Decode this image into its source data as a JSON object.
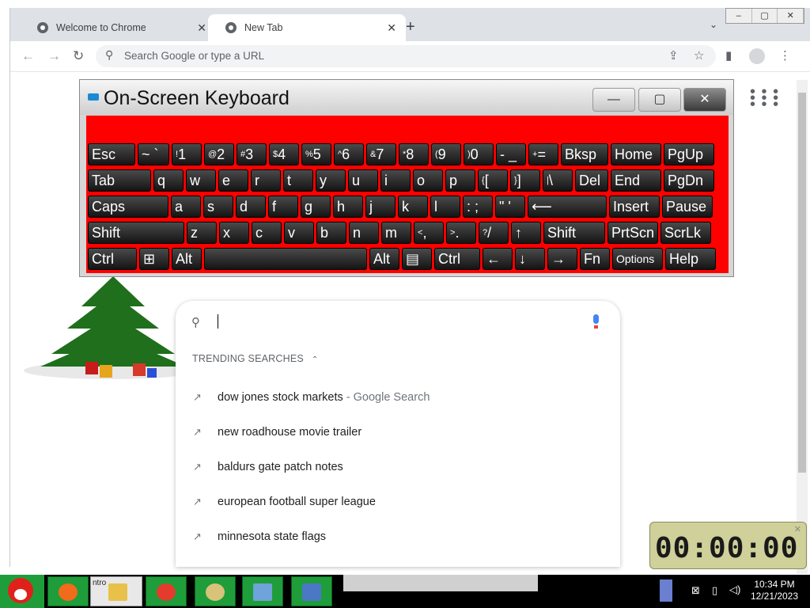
{
  "browser": {
    "tabs": [
      {
        "title": "Welcome to Chrome",
        "close": "✕"
      },
      {
        "title": "New Tab",
        "close": "✕"
      }
    ],
    "new_tab_symbol": "+",
    "tab_menu_symbol": "⌄",
    "window_buttons": [
      "–",
      "▢",
      "✕"
    ],
    "back_symbol": "←",
    "forward_symbol": "→",
    "reload_symbol": "↻",
    "omnibox_placeholder": "Search Google or type a URL",
    "icons": [
      "share-icon",
      "star-icon",
      "side-panel-icon",
      "profile-icon",
      "kebab-menu-icon",
      "apps-grid-icon",
      "search-icon",
      "mic-icon"
    ]
  },
  "osk": {
    "title": "On-Screen Keyboard",
    "controls": {
      "minimize": "—",
      "restore": "▢",
      "close": "✕"
    },
    "rows": [
      [
        {
          "main": "Esc"
        },
        {
          "main": "~ `"
        },
        {
          "sup": "!",
          "main": "1"
        },
        {
          "sup": "@",
          "main": "2"
        },
        {
          "sup": "#",
          "main": "3"
        },
        {
          "sup": "$",
          "main": "4"
        },
        {
          "sup": "%",
          "main": "5"
        },
        {
          "sup": "^",
          "main": "6"
        },
        {
          "sup": "&",
          "main": "7"
        },
        {
          "sup": "*",
          "main": "8"
        },
        {
          "sup": "(",
          "main": "9"
        },
        {
          "sup": ")",
          "main": "0"
        },
        {
          "main": "- _"
        },
        {
          "sup": "+",
          "main": "="
        },
        {
          "main": "Bksp"
        },
        {
          "main": "Home"
        },
        {
          "main": "PgUp"
        }
      ],
      [
        {
          "main": "Tab"
        },
        {
          "main": "q"
        },
        {
          "main": "w"
        },
        {
          "main": "e"
        },
        {
          "main": "r"
        },
        {
          "main": "t"
        },
        {
          "main": "y"
        },
        {
          "main": "u"
        },
        {
          "main": "i"
        },
        {
          "main": "o"
        },
        {
          "main": "p"
        },
        {
          "sup": "{",
          "main": "["
        },
        {
          "sup": "}",
          "main": "]"
        },
        {
          "sup": "|",
          "main": "\\"
        },
        {
          "main": "Del"
        },
        {
          "main": "End"
        },
        {
          "main": "PgDn"
        }
      ],
      [
        {
          "main": "Caps"
        },
        {
          "main": "a"
        },
        {
          "main": "s"
        },
        {
          "main": "d"
        },
        {
          "main": "f"
        },
        {
          "main": "g"
        },
        {
          "main": "h"
        },
        {
          "main": "j"
        },
        {
          "main": "k"
        },
        {
          "main": "l"
        },
        {
          "main": ": ;"
        },
        {
          "main": "\" '"
        },
        {
          "main": "⟵"
        },
        {
          "main": "Insert"
        },
        {
          "main": "Pause"
        }
      ],
      [
        {
          "main": "Shift"
        },
        {
          "main": "z"
        },
        {
          "main": "x"
        },
        {
          "main": "c"
        },
        {
          "main": "v"
        },
        {
          "main": "b"
        },
        {
          "main": "n"
        },
        {
          "main": "m"
        },
        {
          "sup": "<",
          "main": ","
        },
        {
          "sup": ">",
          "main": "."
        },
        {
          "sup": "?",
          "main": "/"
        },
        {
          "main": "↑"
        },
        {
          "main": "Shift"
        },
        {
          "main": "PrtScn"
        },
        {
          "main": "ScrLk"
        }
      ],
      [
        {
          "main": "Ctrl"
        },
        {
          "main": "⊞"
        },
        {
          "main": "Alt"
        },
        {
          "main": ""
        },
        {
          "main": "Alt"
        },
        {
          "main": "▤"
        },
        {
          "main": "Ctrl"
        },
        {
          "main": "←"
        },
        {
          "main": "↓"
        },
        {
          "main": "→"
        },
        {
          "main": "Fn"
        },
        {
          "main": "Options"
        },
        {
          "main": "Help"
        }
      ]
    ]
  },
  "suggestions": {
    "heading": "TRENDING SEARCHES",
    "heading_chevron": "⌃",
    "trend_icon": "↗",
    "items": [
      {
        "text": "dow jones stock markets",
        "suffix": " - Google Search"
      },
      {
        "text": "new roadhouse movie trailer",
        "suffix": ""
      },
      {
        "text": "baldurs gate patch notes",
        "suffix": ""
      },
      {
        "text": "european football super league",
        "suffix": ""
      },
      {
        "text": "minnesota state flags",
        "suffix": ""
      }
    ]
  },
  "timer": {
    "value": "00:00:00",
    "close": "✕"
  },
  "taskbar": {
    "time": "10:34 PM",
    "date": "12/21/2023",
    "apps": [
      "firefox-icon",
      "file-explorer-icon",
      "chrome-icon",
      "paint-icon",
      "control-panel-icon",
      "computer-icon"
    ],
    "partial_label": "ntro"
  }
}
